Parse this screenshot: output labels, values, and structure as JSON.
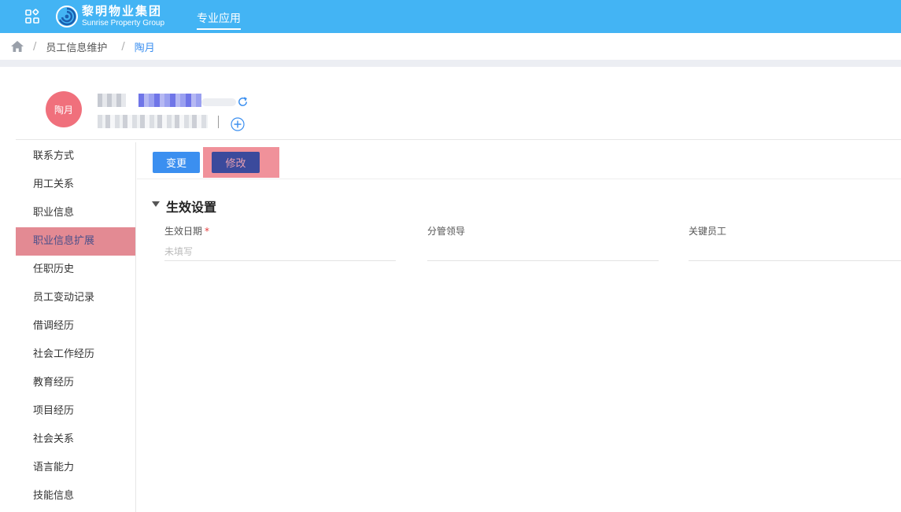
{
  "topbar": {
    "logo_cn": "黎明物业集团",
    "logo_en": "Sunrise Property Group",
    "nav_app": "专业应用",
    "bg_color": "#43b4f4"
  },
  "breadcrumb": {
    "items": [
      "员工信息维护",
      "陶月"
    ],
    "separator": "/"
  },
  "profile": {
    "avatar_text": "陶月",
    "avatar_color": "#f0707c"
  },
  "sidebar": {
    "items": [
      {
        "label": "联系方式"
      },
      {
        "label": "用工关系"
      },
      {
        "label": "职业信息"
      },
      {
        "label": "职业信息扩展"
      },
      {
        "label": "任职历史"
      },
      {
        "label": "员工变动记录"
      },
      {
        "label": "借调经历"
      },
      {
        "label": "社会工作经历"
      },
      {
        "label": "教育经历"
      },
      {
        "label": "项目经历"
      },
      {
        "label": "社会关系"
      },
      {
        "label": "语言能力"
      },
      {
        "label": "技能信息"
      }
    ],
    "active": "职业信息扩展"
  },
  "toolbar": {
    "change_label": "变更",
    "edit_label": "修改"
  },
  "section": {
    "title": "生效设置",
    "fields": [
      {
        "label": "生效日期",
        "required": "*",
        "placeholder": "未填写"
      },
      {
        "label": "分管领导",
        "placeholder": ""
      },
      {
        "label": "关键员工",
        "placeholder": ""
      }
    ]
  }
}
